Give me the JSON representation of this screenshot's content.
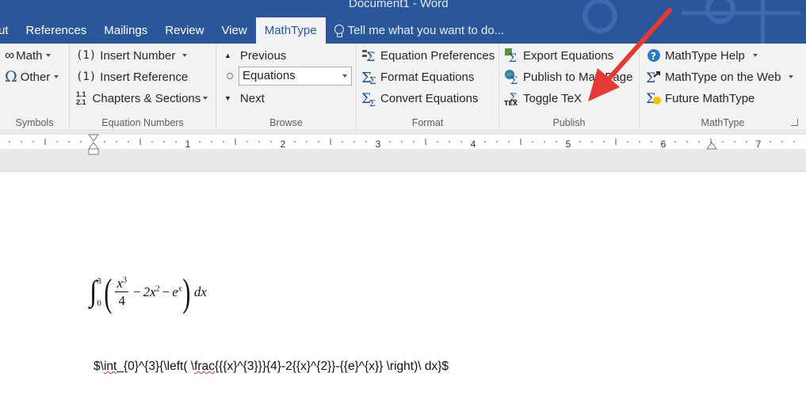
{
  "window": {
    "title": "Document1 - Word"
  },
  "tabs": [
    {
      "label": "ut"
    },
    {
      "label": "References"
    },
    {
      "label": "Mailings"
    },
    {
      "label": "Review"
    },
    {
      "label": "View"
    },
    {
      "label": "MathType"
    }
  ],
  "tell_me": {
    "placeholder": "Tell me what you want to do..."
  },
  "ribbon": {
    "symbols": {
      "label": "Symbols",
      "math": "Math",
      "other": "Other"
    },
    "equation_numbers": {
      "label": "Equation Numbers",
      "insert_number": "Insert Number",
      "insert_reference": "Insert Reference",
      "chapters_sections": "Chapters & Sections",
      "num_icon": "(1)",
      "ref_icon": "(1)",
      "chap_icon_top": "1.1",
      "chap_icon_bottom": "2.1"
    },
    "browse": {
      "label": "Browse",
      "previous": "Previous",
      "selected": "Equations",
      "next": "Next"
    },
    "format": {
      "label": "Format",
      "equation_preferences": "Equation Preferences",
      "format_equations": "Format Equations",
      "convert_equations": "Convert Equations"
    },
    "publish": {
      "label": "Publish",
      "export_equations": "Export Equations",
      "publish_to_mathpage": "Publish to MathPage",
      "toggle_tex": "Toggle TeX"
    },
    "mathtype": {
      "label": "MathType",
      "help": "MathType Help",
      "on_the_web": "MathType on the Web",
      "future": "Future MathType"
    }
  },
  "ruler": {
    "numbers": [
      "1",
      "2",
      "3",
      "4",
      "5",
      "6",
      "7"
    ]
  },
  "document": {
    "equation": {
      "lower": "0",
      "upper": "3",
      "num_base": "x",
      "num_exp": "3",
      "den": "4",
      "minus1": "−",
      "coef": "2x",
      "exp2": "2",
      "minus2": "−",
      "e": "e",
      "exp_x": "x",
      "dx": "dx"
    },
    "latex": {
      "pre": "$\\",
      "int": "int",
      "mid1": "_{0}^{3}{\\left( \\",
      "frac": "frac",
      "rest": "{{{x}^{3}}}{4}-2{{x}^{2}}-{{e}^{x}} \\right)\\ dx}$"
    }
  },
  "colors": {
    "ribbon_blue": "#2b579a",
    "arrow_red": "#e53935"
  }
}
